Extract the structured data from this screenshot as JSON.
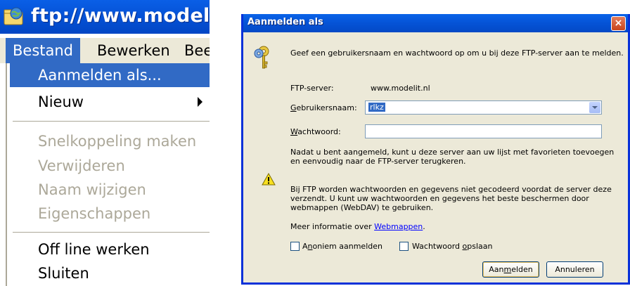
{
  "window": {
    "title": "ftp://www.modelit.n"
  },
  "menubar": {
    "items": [
      "Bestand",
      "Bewerken",
      "Bee"
    ]
  },
  "file_menu": {
    "items": [
      {
        "label": "Aanmelden als...",
        "state": "selected"
      },
      {
        "label": "Nieuw",
        "state": "enabled",
        "submenu": true
      },
      {
        "label": "Snelkoppeling maken",
        "state": "disabled"
      },
      {
        "label": "Verwijderen",
        "state": "disabled"
      },
      {
        "label": "Naam wijzigen",
        "state": "disabled"
      },
      {
        "label": "Eigenschappen",
        "state": "disabled"
      },
      {
        "label": "Off line werken",
        "state": "enabled"
      },
      {
        "label": "Sluiten",
        "state": "enabled"
      }
    ]
  },
  "dialog": {
    "title": "Aanmelden als",
    "intro": "Geef een gebruikersnaam en wachtwoord op om u bij deze FTP-server aan te melden.",
    "server_label": "FTP-server:",
    "server_value": "www.modelit.nl",
    "username_label_pre": "",
    "username_label_u": "G",
    "username_label_post": "ebruikersnaam:",
    "username_value": "rlkz",
    "password_label_u": "W",
    "password_label_post": "achtwoord:",
    "password_value": "",
    "info_line1": "Nadat u bent aangemeld, kunt u deze server aan uw lijst met favorieten toevoegen",
    "info_line2": "en eenvoudig naar de FTP-server terugkeren.",
    "warn_line1": "Bij FTP worden wachtwoorden en gegevens niet gecodeerd voordat de server deze",
    "warn_line2": "verzendt. U kunt uw wachtwoorden en gegevens het beste beschermen door",
    "warn_line3": "webmappen (WebDAV) te gebruiken.",
    "more_info_prefix": "Meer informatie over ",
    "more_info_link": "Webmappen",
    "more_info_suffix": ".",
    "anon_pre": "A",
    "anon_u": "n",
    "anon_post": "oniem aanmelden",
    "save_pre": "Wachtwoord ",
    "save_u": "o",
    "save_post": "pslaan",
    "login_pre": "Aan",
    "login_u": "m",
    "login_post": "elden",
    "cancel_label": "Annuleren",
    "close_glyph": "×"
  },
  "colors": {
    "title_blue": "#0450d4",
    "menu_highlight": "#316ac5",
    "disabled_text": "#aca899",
    "dialog_face": "#ece9d8"
  }
}
